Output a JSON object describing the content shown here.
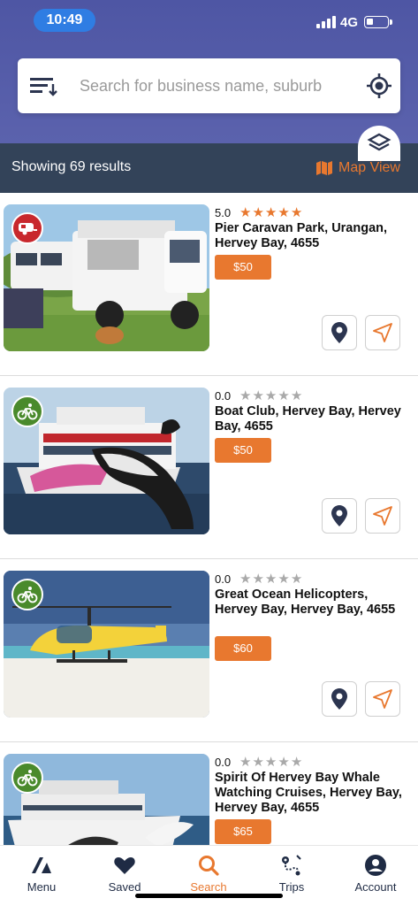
{
  "status": {
    "time": "10:49",
    "network": "4G"
  },
  "search": {
    "placeholder": "Search for business name, suburb"
  },
  "results": {
    "count_text": "Showing 69 results",
    "map_view_label": "Map View"
  },
  "listings": [
    {
      "rating": "5.0",
      "stars": 5,
      "title": "Pier Caravan Park, Urangan, Hervey Bay, 4655",
      "price": "$50",
      "category_icon": "caravan-icon",
      "badge_color": "#c8282d"
    },
    {
      "rating": "0.0",
      "stars": 0,
      "title": "Boat Club, Hervey Bay, Hervey Bay, 4655",
      "price": "$50",
      "category_icon": "cycling-icon",
      "badge_color": "#4a8a2c"
    },
    {
      "rating": "0.0",
      "stars": 0,
      "title": "Great Ocean Helicopters, Hervey Bay, Hervey Bay, 4655",
      "price": "$60",
      "category_icon": "cycling-icon",
      "badge_color": "#4a8a2c"
    },
    {
      "rating": "0.0",
      "stars": 0,
      "title": "Spirit Of Hervey Bay Whale Watching Cruises, Hervey Bay, Hervey Bay, 4655",
      "price": "$65",
      "category_icon": "cycling-icon",
      "badge_color": "#4a8a2c"
    }
  ],
  "nav": {
    "items": [
      {
        "label": "Menu",
        "icon": "logo-icon"
      },
      {
        "label": "Saved",
        "icon": "heart-icon"
      },
      {
        "label": "Search",
        "icon": "search-icon",
        "active": true
      },
      {
        "label": "Trips",
        "icon": "route-icon"
      },
      {
        "label": "Account",
        "icon": "account-icon"
      }
    ]
  },
  "colors": {
    "header": "#4e56a4",
    "results_bar": "#334359",
    "accent": "#e8782f",
    "nav_text": "#1f2b44"
  }
}
